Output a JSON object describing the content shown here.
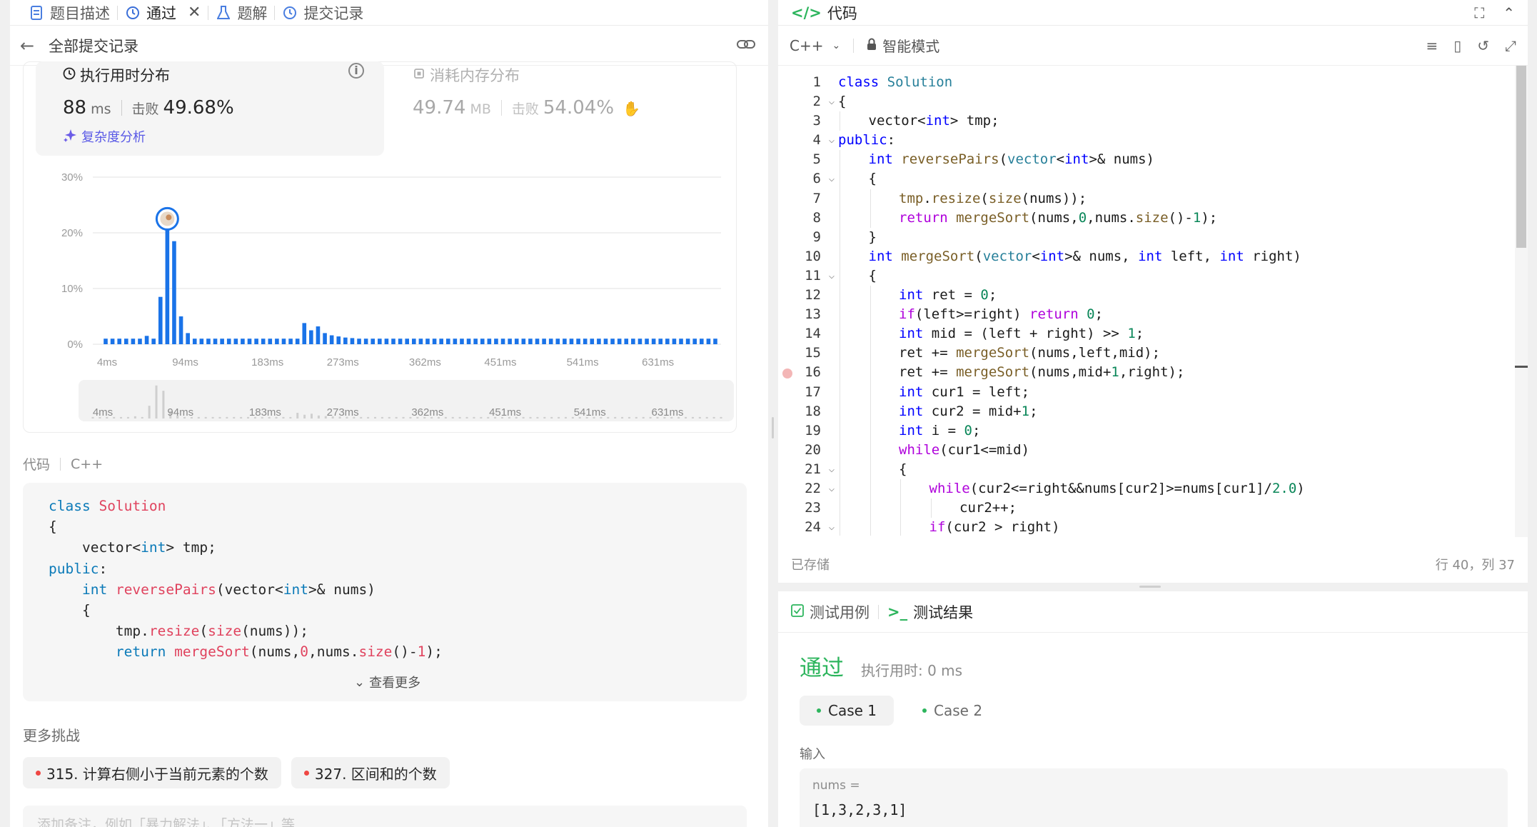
{
  "left_tabs": [
    {
      "label": "题目描述",
      "icon": "document-icon"
    },
    {
      "label": "通过",
      "icon": "history-icon",
      "closable": true
    },
    {
      "label": "题解",
      "icon": "flask-icon"
    },
    {
      "label": "提交记录",
      "icon": "history-icon"
    }
  ],
  "sub_header": {
    "title": "全部提交记录"
  },
  "runtime": {
    "title": "执行用时分布",
    "value": "88",
    "unit": "ms",
    "beat_label": "击败",
    "beat_value": "49.68%",
    "complexity_label": "复杂度分析"
  },
  "memory": {
    "title": "消耗内存分布",
    "value": "49.74",
    "unit": "MB",
    "beat_label": "击败",
    "beat_value": "54.04%"
  },
  "chart_data": {
    "type": "bar",
    "y_ticks": [
      "30%",
      "20%",
      "10%",
      "0%"
    ],
    "ylim": [
      0,
      30
    ],
    "x_ticks": [
      "4ms",
      "94ms",
      "183ms",
      "273ms",
      "362ms",
      "451ms",
      "541ms",
      "631ms"
    ],
    "values": [
      1,
      1,
      1,
      1,
      1,
      1,
      1.5,
      1,
      8.5,
      22,
      18.5,
      5,
      2,
      1,
      1,
      1,
      1,
      1,
      1,
      1,
      1,
      1,
      1,
      1,
      1,
      1,
      1,
      1,
      1,
      3.8,
      2.5,
      3.2,
      2,
      1.6,
      1.4,
      1.2,
      1.1,
      1,
      1,
      1,
      1,
      1,
      1,
      1,
      1,
      1,
      1,
      1,
      1,
      1,
      1,
      1,
      1,
      1,
      1,
      1,
      1,
      1,
      1,
      1,
      1,
      1,
      1,
      1,
      1,
      1,
      1,
      1,
      1,
      1,
      1,
      1,
      1,
      1,
      1,
      1,
      1,
      1,
      1,
      1,
      1,
      1,
      1,
      1,
      1,
      1,
      1,
      1,
      1,
      1
    ],
    "highlight_index": 9,
    "bar_color": "#1a73e8",
    "grid": true
  },
  "brush_ticks": [
    "4ms",
    "94ms",
    "183ms",
    "273ms",
    "362ms",
    "451ms",
    "541ms",
    "631ms"
  ],
  "code_section": {
    "label": "代码",
    "lang": "C++",
    "more": "查看更多",
    "lines": [
      "class Solution",
      "{",
      "    vector<int> tmp;",
      "public:",
      "    int reversePairs(vector<int>& nums)",
      "    {",
      "        tmp.resize(size(nums));",
      "        return mergeSort(nums,0,nums.size()-1);"
    ]
  },
  "challenges": {
    "label": "更多挑战",
    "items": [
      "315. 计算右侧小于当前元素的个数",
      "327. 区间和的个数"
    ]
  },
  "note_placeholder": "添加备注，例如「暴力解法」、「方法一」等",
  "editor": {
    "title": "代码",
    "lang": "C++",
    "mode": "智能模式",
    "status_saved": "已存储",
    "status_pos": "行 40，列 37",
    "lines": [
      {
        "n": "1",
        "fold": false,
        "indent": 0,
        "html": "<span class='kw'>class</span> <span class='cls'>Solution</span>"
      },
      {
        "n": "2",
        "fold": true,
        "indent": 0,
        "html": "{"
      },
      {
        "n": "3",
        "fold": false,
        "indent": 1,
        "html": "vector&lt;<span class='kw'>int</span>&gt; tmp;"
      },
      {
        "n": "4",
        "fold": true,
        "indent": 0,
        "html": "<span class='kw'>public</span>:"
      },
      {
        "n": "5",
        "fold": false,
        "indent": 1,
        "html": "<span class='kw'>int</span> <span class='fn'>reversePairs</span>(<span class='ty'>vector</span>&lt;<span class='kw'>int</span>&gt;&amp; nums)"
      },
      {
        "n": "6",
        "fold": true,
        "indent": 1,
        "html": "{"
      },
      {
        "n": "7",
        "fold": false,
        "indent": 2,
        "html": "<span class='fn'>tmp</span>.<span class='fn'>resize</span>(<span class='fn'>size</span>(nums));"
      },
      {
        "n": "8",
        "fold": false,
        "indent": 2,
        "html": "<span class='ctl'>return</span> <span class='fn'>mergeSort</span>(nums,<span class='num'>0</span>,nums.<span class='fn'>size</span>()-<span class='num'>1</span>);"
      },
      {
        "n": "9",
        "fold": false,
        "indent": 1,
        "html": "}"
      },
      {
        "n": "10",
        "fold": false,
        "indent": 1,
        "html": "<span class='kw'>int</span> <span class='fn'>mergeSort</span>(<span class='ty'>vector</span>&lt;<span class='kw'>int</span>&gt;&amp; nums, <span class='kw'>int</span> left, <span class='kw'>int</span> right)"
      },
      {
        "n": "11",
        "fold": true,
        "indent": 1,
        "html": "{"
      },
      {
        "n": "12",
        "fold": false,
        "indent": 2,
        "html": "<span class='kw'>int</span> ret = <span class='num'>0</span>;"
      },
      {
        "n": "13",
        "fold": false,
        "indent": 2,
        "html": "<span class='ctl'>if</span>(left&gt;=right) <span class='ctl'>return</span> <span class='num'>0</span>;"
      },
      {
        "n": "14",
        "fold": false,
        "indent": 2,
        "html": "<span class='kw'>int</span> mid = (left + right) &gt;&gt; <span class='num'>1</span>;"
      },
      {
        "n": "15",
        "fold": false,
        "indent": 2,
        "html": "ret += <span class='fn'>mergeSort</span>(nums,left,mid);"
      },
      {
        "n": "16",
        "fold": false,
        "indent": 2,
        "bp": true,
        "html": "ret += <span class='fn'>mergeSort</span>(nums,mid+<span class='num'>1</span>,right);"
      },
      {
        "n": "17",
        "fold": false,
        "indent": 2,
        "html": "<span class='kw'>int</span> cur1 = left;"
      },
      {
        "n": "18",
        "fold": false,
        "indent": 2,
        "html": "<span class='kw'>int</span> cur2 = mid+<span class='num'>1</span>;"
      },
      {
        "n": "19",
        "fold": false,
        "indent": 2,
        "html": "<span class='kw'>int</span> i = <span class='num'>0</span>;"
      },
      {
        "n": "20",
        "fold": false,
        "indent": 2,
        "html": "<span class='ctl'>while</span>(cur1&lt;=mid)"
      },
      {
        "n": "21",
        "fold": true,
        "indent": 2,
        "html": "{"
      },
      {
        "n": "22",
        "fold": true,
        "indent": 3,
        "html": "<span class='ctl'>while</span>(cur2&lt;=right&amp;&amp;nums[cur2]&gt;=nums[cur1]/<span class='num'>2.0</span>)"
      },
      {
        "n": "23",
        "fold": false,
        "indent": 4,
        "html": "cur2++;"
      },
      {
        "n": "24",
        "fold": true,
        "indent": 3,
        "html": "<span class='ctl'>if</span>(cur2 &gt; right)"
      }
    ]
  },
  "test": {
    "tab_cases": "测试用例",
    "tab_result": "测试结果",
    "verdict": "通过",
    "runtime": "执行用时: 0 ms",
    "cases": [
      "Case 1",
      "Case 2"
    ],
    "input_label": "输入",
    "var_name": "nums =",
    "var_value": "[1,3,2,3,1]"
  },
  "colors": {
    "accent_green": "#2db55d",
    "bar_blue": "#1a73e8",
    "purple": "#5a5ae6"
  }
}
